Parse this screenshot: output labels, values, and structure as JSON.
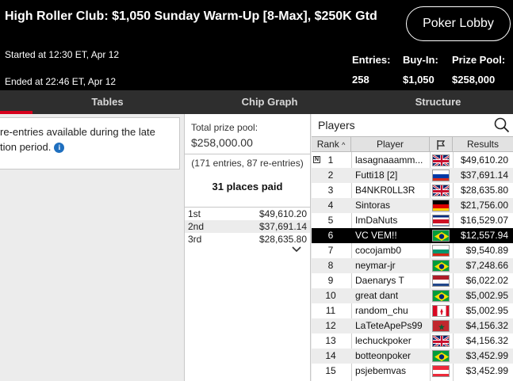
{
  "header": {
    "title": "High Roller Club: $1,050 Sunday Warm-Up [8-Max], $250K Gtd",
    "lobby_button": "Poker Lobby",
    "started": "Started at 12:30 ET, Apr 12",
    "ended": "Ended at 22:46 ET, Apr 12",
    "stats": [
      {
        "label": "Entries:",
        "value": "258"
      },
      {
        "label": "Buy-In:",
        "value": "$1,050"
      },
      {
        "label": "Prize Pool:",
        "value": "$258,000"
      }
    ]
  },
  "tabs": [
    {
      "label": "Tables"
    },
    {
      "label": "Chip Graph"
    },
    {
      "label": "Structure"
    }
  ],
  "info": {
    "line1": "re-entries available during the late",
    "line2": "tion period."
  },
  "prize": {
    "pool_label": "Total prize pool:",
    "pool_value": "$258,000.00",
    "entries_note": "(171 entries, 87 re-entries)",
    "places_paid": "31 places paid",
    "payouts": [
      {
        "place": "1st",
        "amount": "$49,610.20"
      },
      {
        "place": "2nd",
        "amount": "$37,691.14"
      },
      {
        "place": "3rd",
        "amount": "$28,635.80"
      }
    ]
  },
  "players": {
    "title": "Players",
    "columns": {
      "rank": "Rank",
      "player": "Player",
      "results": "Results"
    },
    "rank_badge": "N",
    "rows": [
      {
        "rank": "1",
        "name": "lasagnaaamm...",
        "flag": "gb",
        "result": "$49,610.20"
      },
      {
        "rank": "2",
        "name": "Futti18 [2]",
        "flag": "ru",
        "result": "$37,691.14"
      },
      {
        "rank": "3",
        "name": "B4NKR0LL3R",
        "flag": "gb",
        "result": "$28,635.80"
      },
      {
        "rank": "4",
        "name": "Sintoras",
        "flag": "de",
        "result": "$21,756.00"
      },
      {
        "rank": "5",
        "name": "ImDaNuts",
        "flag": "cr",
        "result": "$16,529.07"
      },
      {
        "rank": "6",
        "name": "VC VEM!!",
        "flag": "br",
        "result": "$12,557.94"
      },
      {
        "rank": "7",
        "name": "cocojamb0",
        "flag": "bg",
        "result": "$9,540.89"
      },
      {
        "rank": "8",
        "name": "neymar-jr",
        "flag": "br",
        "result": "$7,248.66"
      },
      {
        "rank": "9",
        "name": "Daenarys T",
        "flag": "nl",
        "result": "$6,022.02"
      },
      {
        "rank": "10",
        "name": "great dant",
        "flag": "br",
        "result": "$5,002.95"
      },
      {
        "rank": "11",
        "name": "random_chu",
        "flag": "ca",
        "result": "$5,002.95"
      },
      {
        "rank": "12",
        "name": "LaTeteApePs99",
        "flag": "ma",
        "result": "$4,156.32"
      },
      {
        "rank": "13",
        "name": "lechuckpoker",
        "flag": "gb",
        "result": "$4,156.32"
      },
      {
        "rank": "14",
        "name": "botteonpoker",
        "flag": "br",
        "result": "$3,452.99"
      },
      {
        "rank": "15",
        "name": "psjebemvas",
        "flag": "at",
        "result": "$3,452.99"
      }
    ],
    "highlight_rank": "6"
  },
  "colors": {
    "header_bg": "#000000",
    "tab_bar_bg": "#2e2e2e",
    "tab_indicator": "#d6001c",
    "highlight_row": "#000000",
    "info_icon": "#1f6fbf"
  }
}
